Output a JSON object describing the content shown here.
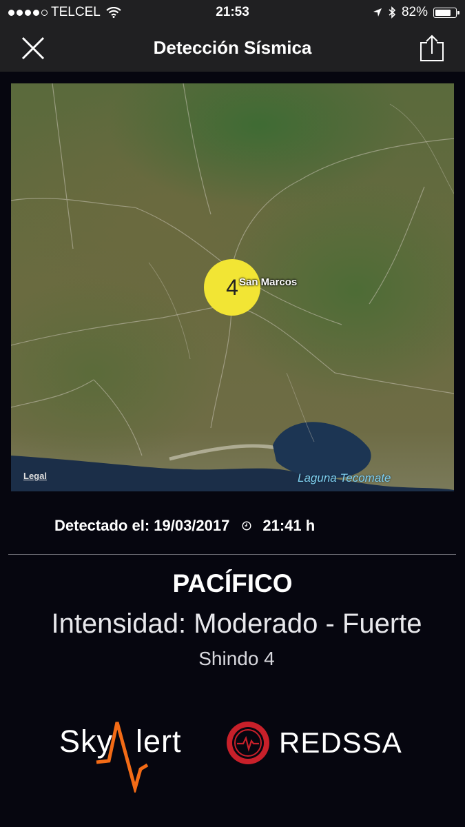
{
  "status_bar": {
    "carrier": "TELCEL",
    "time": "21:53",
    "battery_percent": "82%",
    "battery_level": 0.82,
    "icons": [
      "signal-dots-icon",
      "wifi-icon",
      "location-arrow-icon",
      "bluetooth-icon",
      "battery-icon"
    ]
  },
  "nav": {
    "title": "Detección Sísmica",
    "left_icon": "close-icon",
    "right_icon": "share-icon"
  },
  "map": {
    "marker_value": "4",
    "place_label": "San Marcos",
    "lagoon_label": "Laguna Tecomate",
    "legal_link": "Legal",
    "marker_color": "#f2e534"
  },
  "detection": {
    "prefix": "Detectado el: 19/03/2017",
    "time": "21:41 h"
  },
  "event": {
    "region": "PACÍFICO",
    "intensity": "Intensidad: Moderado - Fuerte",
    "shindo": "Shindo 4"
  },
  "logos": {
    "skyalert_text_left": "Sky",
    "skyalert_text_right": "lert",
    "redssa_text": "REDSSA",
    "skyalert_accent": "#f36b16",
    "redssa_accent": "#c8202a"
  }
}
